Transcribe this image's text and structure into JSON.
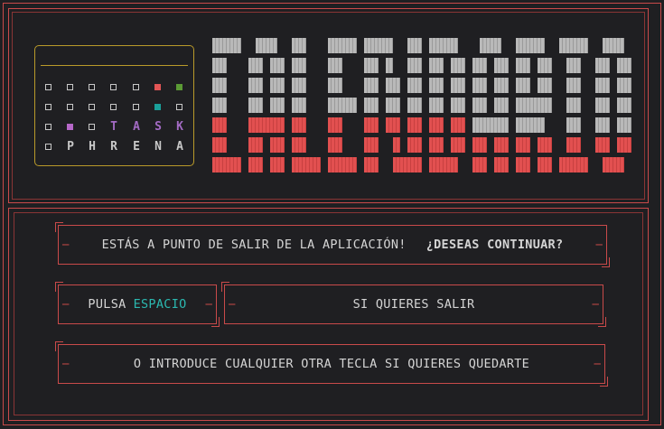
{
  "logo": {
    "rows": [
      {
        "cells": [
          "sq",
          "sq",
          "sq",
          "sq",
          "sq",
          "red",
          "green"
        ]
      },
      {
        "cells": [
          "sq",
          "sq",
          "sq",
          "sq",
          "sq",
          "teal",
          "sq"
        ]
      },
      {
        "cells": [
          "sq",
          "purple",
          "sq",
          "T",
          "A",
          "S",
          "K"
        ]
      },
      {
        "cells": [
          "sq",
          "P",
          "H",
          "R",
          "E",
          "N",
          "A"
        ]
      }
    ],
    "colors": {
      "red": "#e25555",
      "green": "#5b9a35",
      "teal": "#1aa09a",
      "purple": "#b668c9",
      "task_letter": "#a36bc4",
      "phrena_letter": "#c8c8c8"
    }
  },
  "dialog": {
    "warning_text": "ESTÁS A PUNTO DE SALIR DE LA APLICACIÓN!",
    "question_text": "¿DESEAS CONTINUAR?",
    "press_label": "PULSA",
    "key_name": "ESPACIO",
    "exit_text": "SI QUIERES SALIR",
    "stay_text": "O INTRODUCE CUALQUIER OTRA TECLA SI QUIERES QUEDARTE"
  },
  "colors": {
    "frame": "#c94a4a",
    "gold": "#b99a2a",
    "gray_block": "#b9b9b9",
    "red_block": "#e25050",
    "background": "#1f1f22"
  }
}
